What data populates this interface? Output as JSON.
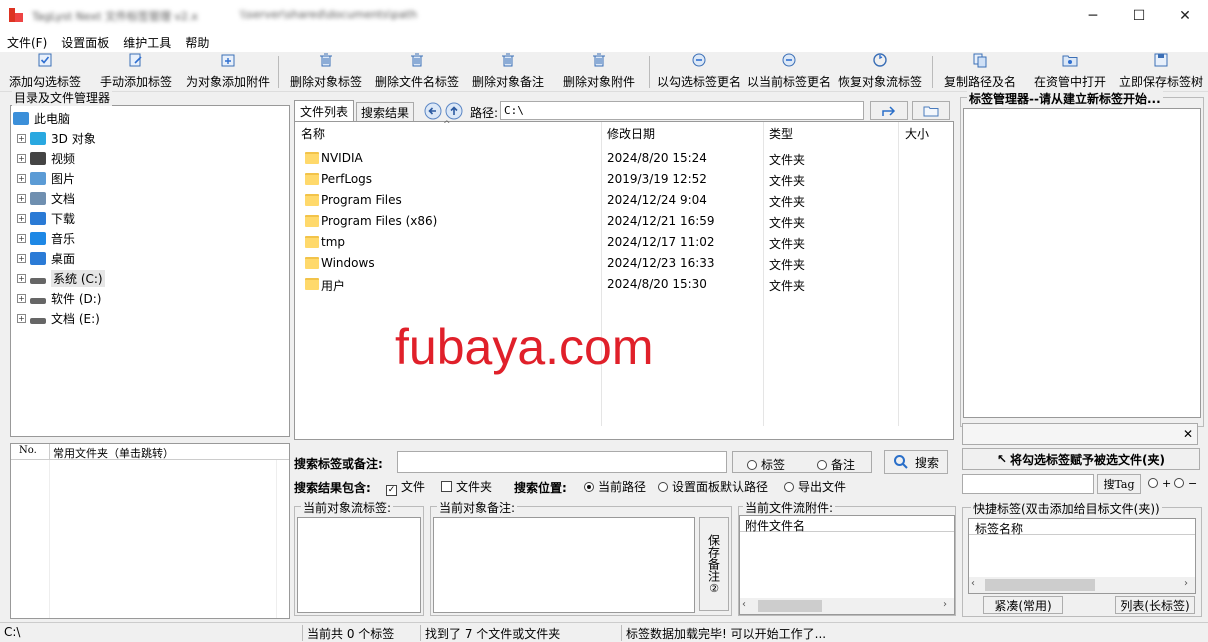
{
  "window": {
    "title": "TagLyst Next 文件标签管理 v2.x",
    "subtitle": "\\\\server\\shared\\documents\\path",
    "min": "─",
    "max": "☐",
    "close": "✕"
  },
  "menu": [
    "文件(F)",
    "设置面板",
    "维护工具",
    "帮助"
  ],
  "toolbar": [
    {
      "label": "添加勾选标签",
      "icon": "check-tag-icon"
    },
    {
      "label": "手动添加标签",
      "icon": "edit-tag-icon"
    },
    {
      "label": "为对象添加附件",
      "icon": "attach-icon"
    },
    {
      "label": "删除对象标签",
      "icon": "trash-icon"
    },
    {
      "label": "删除文件名标签",
      "icon": "trash-icon"
    },
    {
      "label": "删除对象备注",
      "icon": "trash-icon"
    },
    {
      "label": "删除对象附件",
      "icon": "trash-icon"
    },
    {
      "label": "以勾选标签更名",
      "icon": "rename-icon"
    },
    {
      "label": "以当前标签更名",
      "icon": "rename-icon"
    },
    {
      "label": "恢复对象流标签",
      "icon": "restore-icon"
    },
    {
      "label": "复制路径及名",
      "icon": "copy-icon"
    },
    {
      "label": "在资管中打开",
      "icon": "open-folder-icon"
    },
    {
      "label": "立即保存标签树",
      "icon": "save-icon"
    }
  ],
  "left": {
    "group_title": "目录及文件管理器",
    "tree": [
      {
        "label": "此电脑",
        "icon": "computer-icon",
        "root": true
      },
      {
        "label": "3D 对象",
        "icon": "cube-icon"
      },
      {
        "label": "视频",
        "icon": "video-icon"
      },
      {
        "label": "图片",
        "icon": "picture-icon"
      },
      {
        "label": "文档",
        "icon": "document-icon"
      },
      {
        "label": "下载",
        "icon": "download-icon"
      },
      {
        "label": "音乐",
        "icon": "music-icon"
      },
      {
        "label": "桌面",
        "icon": "desktop-icon"
      },
      {
        "label": "系统 (C:)",
        "icon": "drive-icon",
        "selected": true
      },
      {
        "label": "软件 (D:)",
        "icon": "drive-icon"
      },
      {
        "label": "文档 (E:)",
        "icon": "drive-icon"
      }
    ],
    "fav_headers": [
      "No.",
      "常用文件夹（单击跳转）"
    ]
  },
  "center": {
    "tabs": [
      "文件列表",
      "搜索结果"
    ],
    "path_label": "路径:",
    "path_value": "C:\\",
    "columns": [
      "名称",
      "修改日期",
      "类型",
      "大小"
    ],
    "rows": [
      {
        "name": "NVIDIA",
        "date": "2024/8/20 15:24",
        "type": "文件夹"
      },
      {
        "name": "PerfLogs",
        "date": "2019/3/19 12:52",
        "type": "文件夹"
      },
      {
        "name": "Program Files",
        "date": "2024/12/24 9:04",
        "type": "文件夹"
      },
      {
        "name": "Program Files (x86)",
        "date": "2024/12/21 16:59",
        "type": "文件夹"
      },
      {
        "name": "tmp",
        "date": "2024/12/17 11:02",
        "type": "文件夹"
      },
      {
        "name": "Windows",
        "date": "2024/12/23 16:33",
        "type": "文件夹"
      },
      {
        "name": "用户",
        "date": "2024/8/20 15:30",
        "type": "文件夹"
      }
    ],
    "watermark": "fubaya.com"
  },
  "search": {
    "label": "搜索标签或备注:",
    "opt_tag": "标签",
    "opt_note": "备注",
    "button": "搜索",
    "include_label": "搜索结果包含:",
    "inc_file": "文件",
    "inc_folder": "文件夹",
    "loc_label": "搜索位置:",
    "loc_current": "当前路径",
    "loc_default": "设置面板默认路径",
    "loc_export": "导出文件"
  },
  "bottom": {
    "stream_tags": "当前对象流标签:",
    "note": "当前对象备注:",
    "save_note": "保存备注",
    "save_note_num": "②",
    "attachments": "当前文件流附件:",
    "attach_col": "附件文件名"
  },
  "right": {
    "title": "标签管理器--请从建立新标签开始...",
    "assign_btn": "将勾选标签赋予被选文件(夹)",
    "search_tag": "搜Tag",
    "plus": "+",
    "minus": "−",
    "quick_title": "快捷标签(双击添加给目标文件(夹))",
    "quick_col": "标签名称",
    "compact_btn": "紧凑(常用)",
    "list_btn": "列表(长标签)"
  },
  "status": {
    "path": "C:\\",
    "tags": "当前共 0 个标签",
    "found": "找到了 7 个文件或文件夹",
    "msg": "标签数据加载完毕! 可以开始工作了..."
  }
}
